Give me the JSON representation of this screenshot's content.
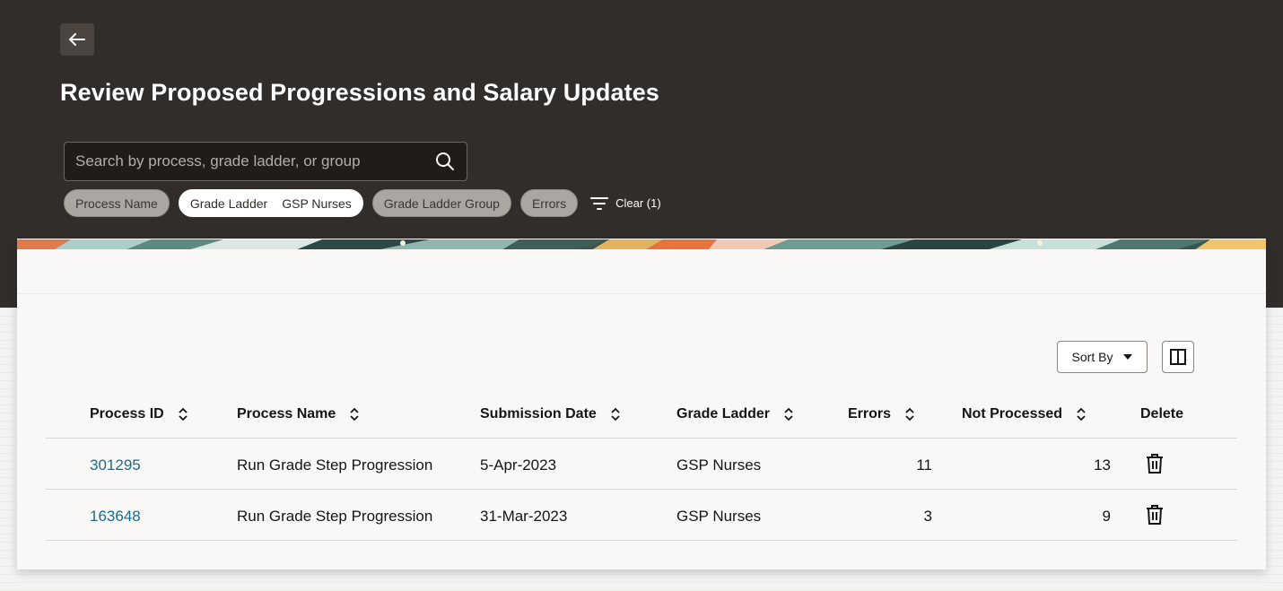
{
  "page": {
    "title": "Review Proposed Progressions and Salary Updates"
  },
  "search": {
    "placeholder": "Search by process, grade ladder, or group",
    "value": ""
  },
  "filters": {
    "chips": [
      {
        "label": "Process Name",
        "value": "",
        "active": false
      },
      {
        "label": "Grade Ladder",
        "value": "GSP Nurses",
        "active": true
      },
      {
        "label": "Grade Ladder Group",
        "value": "",
        "active": false
      },
      {
        "label": "Errors",
        "value": "",
        "active": false
      }
    ],
    "clear_label": "Clear (1)"
  },
  "toolbar": {
    "sort_label": "Sort By"
  },
  "table": {
    "columns": [
      "Process ID",
      "Process Name",
      "Submission Date",
      "Grade Ladder",
      "Errors",
      "Not Processed",
      "Delete"
    ],
    "rows": [
      {
        "process_id": "301295",
        "process_name": "Run Grade Step Progression",
        "submission_date": "5-Apr-2023",
        "grade_ladder": "GSP Nurses",
        "errors": "11",
        "not_processed": "13"
      },
      {
        "process_id": "163648",
        "process_name": "Run Grade Step Progression",
        "submission_date": "31-Mar-2023",
        "grade_ladder": "GSP Nurses",
        "errors": "3",
        "not_processed": "9"
      }
    ]
  },
  "icons": {
    "back": "arrow-left-icon",
    "search": "search-icon",
    "filter": "filter-icon",
    "sort": "sort-updown-icon",
    "columns": "column-layout-icon",
    "delete": "trash-icon"
  },
  "colors": {
    "header_bg": "#312d2a",
    "link": "#1c6b8f",
    "chip_active_bg": "#ffffff",
    "chip_bg": "#aaa6a1"
  }
}
